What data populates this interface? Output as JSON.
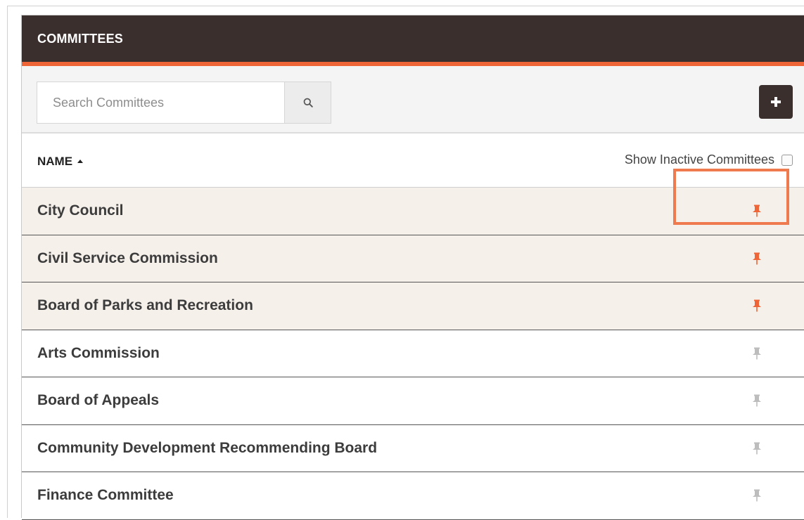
{
  "panel": {
    "title": "COMMITTEES"
  },
  "search": {
    "placeholder": "Search Committees",
    "value": ""
  },
  "icons": {
    "search": "search-icon",
    "add": "plus-icon",
    "sort": "sort-ascending-icon",
    "pin": "pin-icon"
  },
  "columns": {
    "name": "NAME",
    "sort": "ascending"
  },
  "filter": {
    "show_inactive_label": "Show Inactive Committees",
    "checked": false
  },
  "colors": {
    "header_bg": "#3a2f2c",
    "accent": "#ef6537",
    "pinned_row": "#f6f0eb",
    "pin_active": "#ef6537",
    "pin_inactive": "#bdbdbd"
  },
  "committees": [
    {
      "name": "City Council",
      "pinned": true
    },
    {
      "name": "Civil Service Commission",
      "pinned": true
    },
    {
      "name": "Board of Parks and Recreation",
      "pinned": true
    },
    {
      "name": "Arts Commission",
      "pinned": false
    },
    {
      "name": "Board of Appeals",
      "pinned": false
    },
    {
      "name": "Community Development Recommending Board",
      "pinned": false
    },
    {
      "name": "Finance Committee",
      "pinned": false
    }
  ]
}
